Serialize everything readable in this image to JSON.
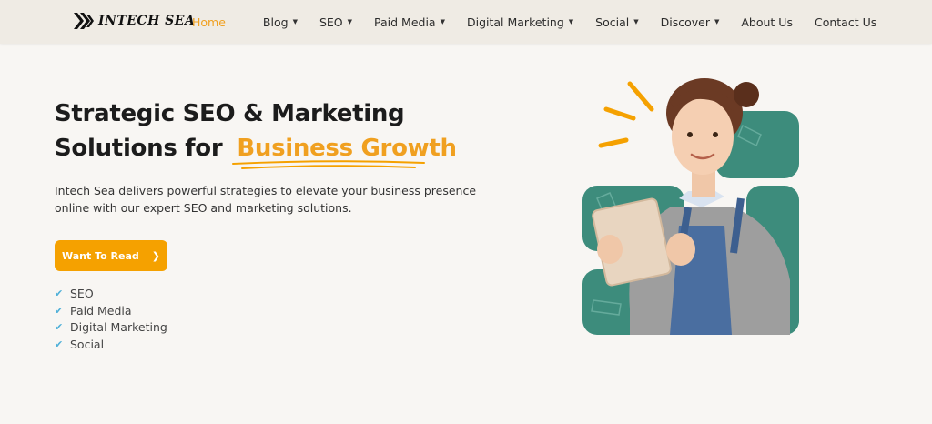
{
  "brand": {
    "name": "INTECH SEA"
  },
  "nav": {
    "items": [
      {
        "label": "Home",
        "dropdown": false,
        "active": true
      },
      {
        "label": "Blog",
        "dropdown": true
      },
      {
        "label": "SEO",
        "dropdown": true
      },
      {
        "label": "Paid Media",
        "dropdown": true
      },
      {
        "label": "Digital Marketing",
        "dropdown": true
      },
      {
        "label": "Social",
        "dropdown": true
      },
      {
        "label": "Discover",
        "dropdown": true
      },
      {
        "label": "About Us",
        "dropdown": false
      },
      {
        "label": "Contact Us",
        "dropdown": false
      }
    ]
  },
  "hero": {
    "title_line1": "Strategic SEO & Marketing",
    "title_line2": "Solutions for",
    "title_highlight": "Business Growth",
    "description": "Intech Sea delivers powerful strategies to elevate your business presence online with our expert SEO and marketing solutions.",
    "cta_label": "Want To Read",
    "features": [
      "SEO",
      "Paid Media",
      "Digital Marketing",
      "Social"
    ]
  },
  "colors": {
    "accent": "#f5a100",
    "highlight_text": "#f0a020",
    "check": "#4fb0d8",
    "illustration_panel": "#3d8c7c",
    "header_bg": "#efebe4",
    "page_bg": "#f8f6f3"
  },
  "icons": {
    "logo": "chevron-logo-icon",
    "dropdown": "caret-down-icon",
    "cta": "chevron-right-icon",
    "feature": "check-icon"
  }
}
